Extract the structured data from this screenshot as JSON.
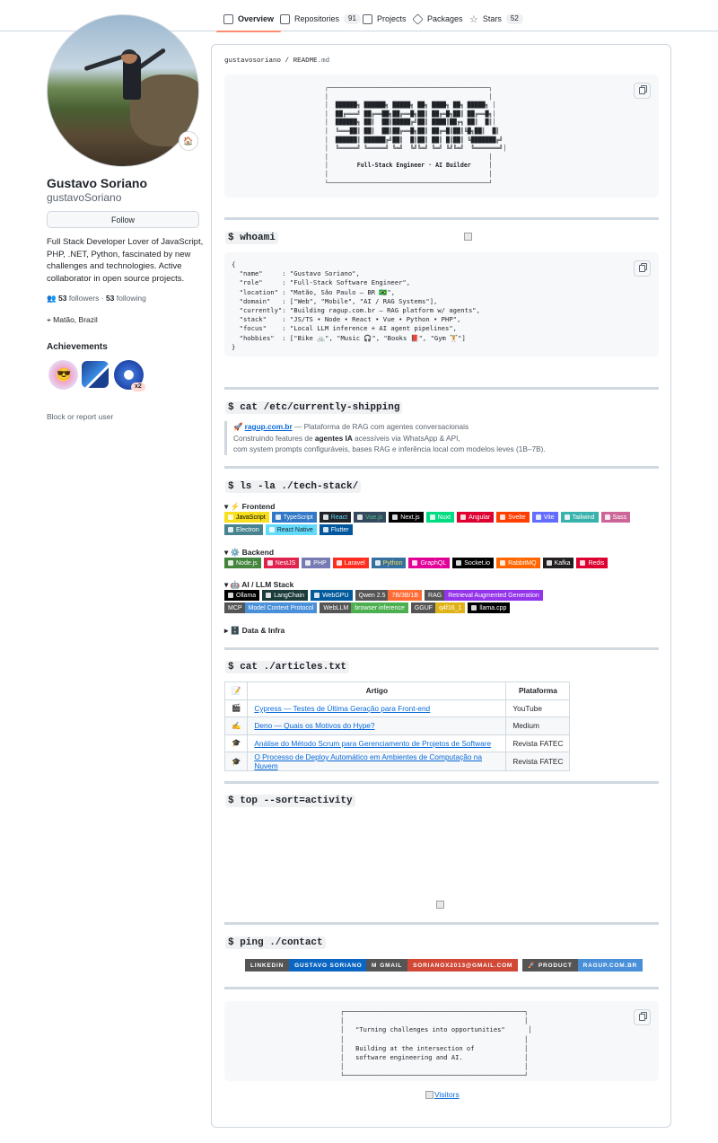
{
  "nav": {
    "tabs": [
      {
        "label": "Overview",
        "count": ""
      },
      {
        "label": "Repositories",
        "count": "91"
      },
      {
        "label": "Projects",
        "count": ""
      },
      {
        "label": "Packages",
        "count": ""
      },
      {
        "label": "Stars",
        "count": "52"
      }
    ]
  },
  "profile": {
    "status_emoji": "🏠",
    "name": "Gustavo Soriano",
    "login": "gustavoSoriano",
    "follow_label": "Follow",
    "bio": "Full Stack Developer Lover of JavaScript, PHP, .NET, Python, fascinated by new challenges and technologies. Active collaborator in open source projects.",
    "followers": "53",
    "followers_label": "followers",
    "separator": "·",
    "following": "53",
    "following_label": "following",
    "location": "Matão, Brazil",
    "achievements_title": "Achievements",
    "achievement_multiplier": "x2",
    "block_label": "Block or report user"
  },
  "readme": {
    "path_user": "gustavosoriano",
    "path_sep": "/",
    "path_file": "README",
    "path_ext": ".md",
    "banner_art": "┌─────────────────────────────────────────────┐\n│                                             │\n│  ██████╗ ██████╗ █████╗ ██╗ ████╗ ██╗ █████╗ │\n│  ██╔═══╝ ██╔══██╗██╔══█╗██║ ██╔═█╗██║ ██╔══█╗│\n│  ██████╗ ██║  ██║█████╔╝██║ ████║██╔╗ ██║  █║│\n│  ╚═══██║ ██║  ██║██╔══█╗██║ ██╔═█║██║╚█╗██║  █║\n│  ██████║ ██████╔╝██║  █║██║ ██║ █║██║ ╚███████╔╝\n│  ╚═════╝ ╚═════╝ ╚═╝  ╚╝╚═╝ ╚═╝ ╚╝╚═╝  ╚═══════╝│\n│                                             │\n│        Full-Stack Engineer · AI Builder     │\n│                                             │\n└─────────────────────────────────────────────┘",
    "whoami_heading": "$ whoami",
    "whoami_code": "{\n  \"name\"     : \"Gustavo Soriano\",\n  \"role\"     : \"Full-Stack Software Engineer\",\n  \"location\" : \"Matão, São Paulo — BR 🇧🇷\",\n  \"domain\"   : [\"Web\", \"Mobile\", \"AI / RAG Systems\"],\n  \"currently\": \"Building ragup.com.br — RAG platform w/ agents\",\n  \"stack\"    : \"JS/TS • Node • React • Vue • Python • PHP\",\n  \"focus\"    : \"Local LLM inference + AI agent pipelines\",\n  \"hobbies\"  : [\"Bike 🚲\", \"Music 🎧\", \"Books 📕\", \"Gym 🏋\"]\n}",
    "shipping_heading": "$ cat /etc/currently-shipping",
    "shipping_rocket": "🚀",
    "shipping_link": "ragup.com.br",
    "shipping_line1_rest": " — Plataforma de RAG com agentes conversacionais",
    "shipping_line2_a": "Construindo features de ",
    "shipping_line2_b": "agentes IA",
    "shipping_line2_c": " acessíveis via WhatsApp & API,",
    "shipping_line3": "com system prompts configuráveis, bases RAG e inferência local com modelos leves (1B–7B).",
    "techstack_heading": "$ ls -la ./tech-stack/",
    "frontend_label": "▾ ⚡ Frontend",
    "frontend": [
      {
        "label": "JavaScript",
        "bg": "#f7df1e",
        "fg": "#000"
      },
      {
        "label": "TypeScript",
        "bg": "#3178c6",
        "fg": "#fff"
      },
      {
        "label": "React",
        "bg": "#20232a",
        "fg": "#61dafb"
      },
      {
        "label": "Vue.js",
        "bg": "#35495e",
        "fg": "#4fc08d"
      },
      {
        "label": "Next.js",
        "bg": "#000000",
        "fg": "#fff"
      },
      {
        "label": "Nuxt",
        "bg": "#00dc82",
        "fg": "#fff"
      },
      {
        "label": "Angular",
        "bg": "#dd0031",
        "fg": "#fff"
      },
      {
        "label": "Svelte",
        "bg": "#ff3e00",
        "fg": "#fff"
      },
      {
        "label": "Vite",
        "bg": "#646cff",
        "fg": "#fff"
      },
      {
        "label": "Tailwind",
        "bg": "#38b2ac",
        "fg": "#fff"
      },
      {
        "label": "Sass",
        "bg": "#cc6699",
        "fg": "#fff"
      },
      {
        "label": "Electron",
        "bg": "#47848f",
        "fg": "#fff"
      },
      {
        "label": "React Native",
        "bg": "#61dafb",
        "fg": "#20232a"
      },
      {
        "label": "Flutter",
        "bg": "#02569b",
        "fg": "#fff"
      }
    ],
    "backend_label": "▾ ⚙️ Backend",
    "backend": [
      {
        "label": "Node.js",
        "bg": "#43853d",
        "fg": "#fff"
      },
      {
        "label": "NestJS",
        "bg": "#e0234e",
        "fg": "#fff"
      },
      {
        "label": "PHP",
        "bg": "#777bb4",
        "fg": "#fff"
      },
      {
        "label": "Laravel",
        "bg": "#ff2d20",
        "fg": "#fff"
      },
      {
        "label": "Python",
        "bg": "#3670a0",
        "fg": "#ffdd54"
      },
      {
        "label": "GraphQL",
        "bg": "#e10098",
        "fg": "#fff"
      },
      {
        "label": "Socket.io",
        "bg": "#010101",
        "fg": "#fff"
      },
      {
        "label": "RabbitMQ",
        "bg": "#ff6600",
        "fg": "#fff"
      },
      {
        "label": "Kafka",
        "bg": "#231f20",
        "fg": "#fff"
      },
      {
        "label": "Redis",
        "bg": "#dd0031",
        "fg": "#fff"
      }
    ],
    "ai_label": "▾ 🤖 AI / LLM Stack",
    "ai": [
      {
        "label": "Ollama",
        "value": "",
        "bg": "#000000",
        "vbg": ""
      },
      {
        "label": "LangChain",
        "value": "",
        "bg": "#1c3c3c",
        "vbg": ""
      },
      {
        "label": "WebGPU",
        "value": "",
        "bg": "#005a9c",
        "vbg": ""
      },
      {
        "label": "Qwen 2.5",
        "value": "7B/3B/1B",
        "bg": "#555555",
        "vbg": "#ff6b35"
      },
      {
        "label": "RAG",
        "value": "Retrieval Augmented Generation",
        "bg": "#555555",
        "vbg": "#9333ea"
      },
      {
        "label": "MCP",
        "value": "Model Context Protocol",
        "bg": "#555555",
        "vbg": "#4a90d9"
      },
      {
        "label": "WebLLM",
        "value": "browser inference",
        "bg": "#555555",
        "vbg": "#4caf50"
      },
      {
        "label": "GGUF",
        "value": "q4f16_1",
        "bg": "#555555",
        "vbg": "#dfb317"
      },
      {
        "label": "llama.cpp",
        "value": "",
        "bg": "#000000",
        "vbg": ""
      }
    ],
    "data_label": "▸ 🗄️ Data & Infra",
    "articles_heading": "$ cat ./articles.txt",
    "articles_cols": [
      "📝",
      "Artigo",
      "Plataforma"
    ],
    "articles": [
      {
        "icon": "🎬",
        "title": "Cypress — Testes de Última Geração para Front-end",
        "platform": "YouTube"
      },
      {
        "icon": "✍️",
        "title": "Deno — Quais os Motivos do Hype?",
        "platform": "Medium"
      },
      {
        "icon": "🎓",
        "title": "Análise do Método Scrum para Gerenciamento de Projetos de Software",
        "platform": "Revista FATEC"
      },
      {
        "icon": "🎓",
        "title": "O Processo de Deploy Automático em Ambientes de Computação na Nuvem",
        "platform": "Revista FATEC"
      }
    ],
    "top_heading": "$ top --sort=activity",
    "contact_heading": "$ ping ./contact",
    "contacts": [
      {
        "label": "LINKEDIN",
        "value": "GUSTAVO SORIANO",
        "vbg": "#0a66c2",
        "icon": ""
      },
      {
        "label": "GMAIL",
        "value": "SORIANOX2013@GMAIL.COM",
        "vbg": "#d14836",
        "icon": "M"
      },
      {
        "label": "PRODUCT",
        "value": "RAGUP.COM.BR",
        "vbg": "#4a90d9",
        "icon": "🚀"
      }
    ],
    "quote_box": "┌───────────────────────────────────────────────┐\n│                                               │\n│   \"Turning challenges into opportunities\"      │\n│                                               │\n│   Building at the intersection of             │\n│   software engineering and AI.                │\n│                                               │\n└───────────────────────────────────────────────┘",
    "visitors_label": "Visitors"
  },
  "colors": {
    "accent": "#fd8c73",
    "link": "#0969da",
    "border": "#d0d7de",
    "muted": "#59636e"
  }
}
